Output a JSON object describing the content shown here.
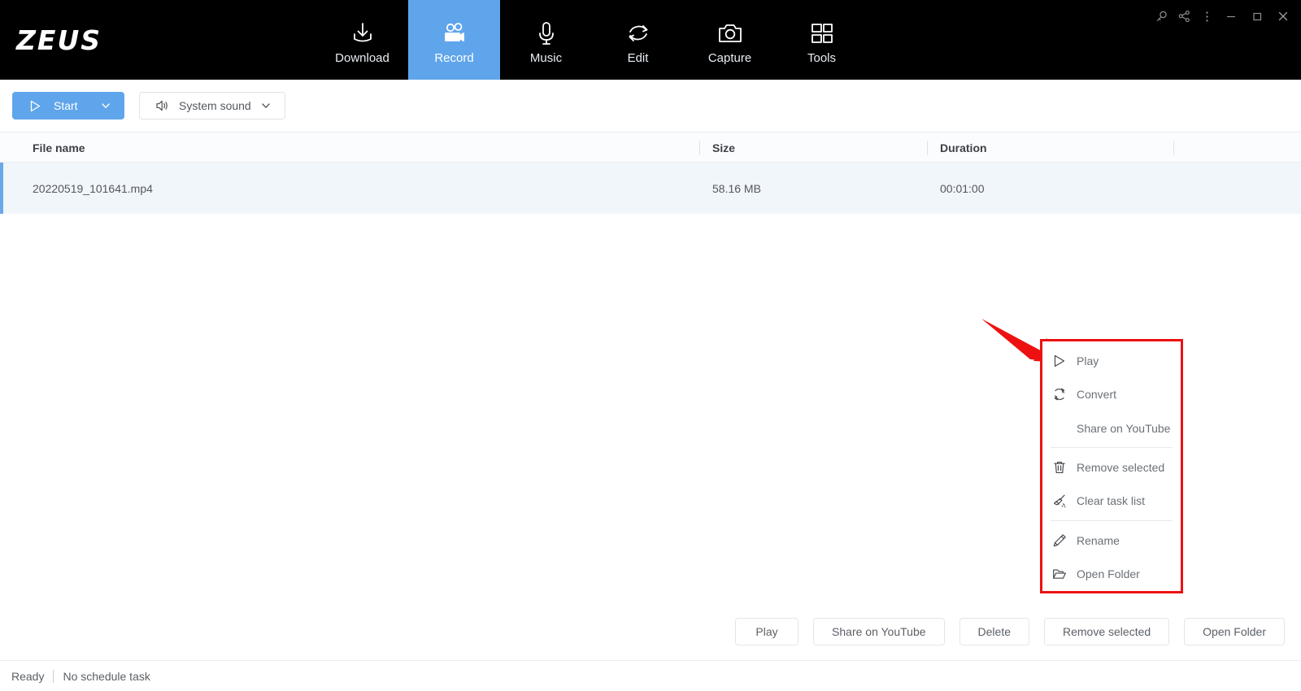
{
  "app": {
    "logo": "ZEUS",
    "accent_blue": "#5fa5eb",
    "annotation_red": "#ee1111"
  },
  "nav": {
    "tabs": [
      {
        "label": "Download",
        "icon": "download-icon",
        "active": false
      },
      {
        "label": "Record",
        "icon": "video-camera-icon",
        "active": true
      },
      {
        "label": "Music",
        "icon": "microphone-icon",
        "active": false
      },
      {
        "label": "Edit",
        "icon": "refresh-circle-icon",
        "active": false
      },
      {
        "label": "Capture",
        "icon": "camera-icon",
        "active": false
      },
      {
        "label": "Tools",
        "icon": "grid-squares-icon",
        "active": false
      }
    ]
  },
  "window_controls": [
    {
      "name": "key-icon",
      "glyph": "key"
    },
    {
      "name": "share-icon",
      "glyph": "share"
    },
    {
      "name": "more-menu-icon",
      "glyph": "dots"
    },
    {
      "name": "minimize-icon",
      "glyph": "minimize"
    },
    {
      "name": "maximize-icon",
      "glyph": "maximize"
    },
    {
      "name": "close-icon",
      "glyph": "close"
    }
  ],
  "toolbar": {
    "start_label": "Start",
    "sound_label": "System sound"
  },
  "table": {
    "columns": [
      "File name",
      "Size",
      "Duration"
    ],
    "rows": [
      {
        "file_name": "20220519_101641.mp4",
        "size": "58.16 MB",
        "duration": "00:01:00",
        "selected": true
      }
    ]
  },
  "context_menu": {
    "groups": [
      [
        {
          "label": "Play",
          "icon": "play-icon"
        },
        {
          "label": "Convert",
          "icon": "convert-refresh-icon"
        },
        {
          "label": "Share on YouTube",
          "icon": "none"
        }
      ],
      [
        {
          "label": "Remove selected",
          "icon": "trash-icon"
        },
        {
          "label": "Clear task list",
          "icon": "broom-icon"
        }
      ],
      [
        {
          "label": "Rename",
          "icon": "pencil-icon"
        },
        {
          "label": "Open Folder",
          "icon": "folder-icon"
        }
      ]
    ]
  },
  "bottom_buttons": [
    {
      "label": "Play"
    },
    {
      "label": "Share on YouTube"
    },
    {
      "label": "Delete"
    },
    {
      "label": "Remove selected"
    },
    {
      "label": "Open Folder"
    }
  ],
  "status": {
    "state": "Ready",
    "schedule": "No schedule task"
  }
}
